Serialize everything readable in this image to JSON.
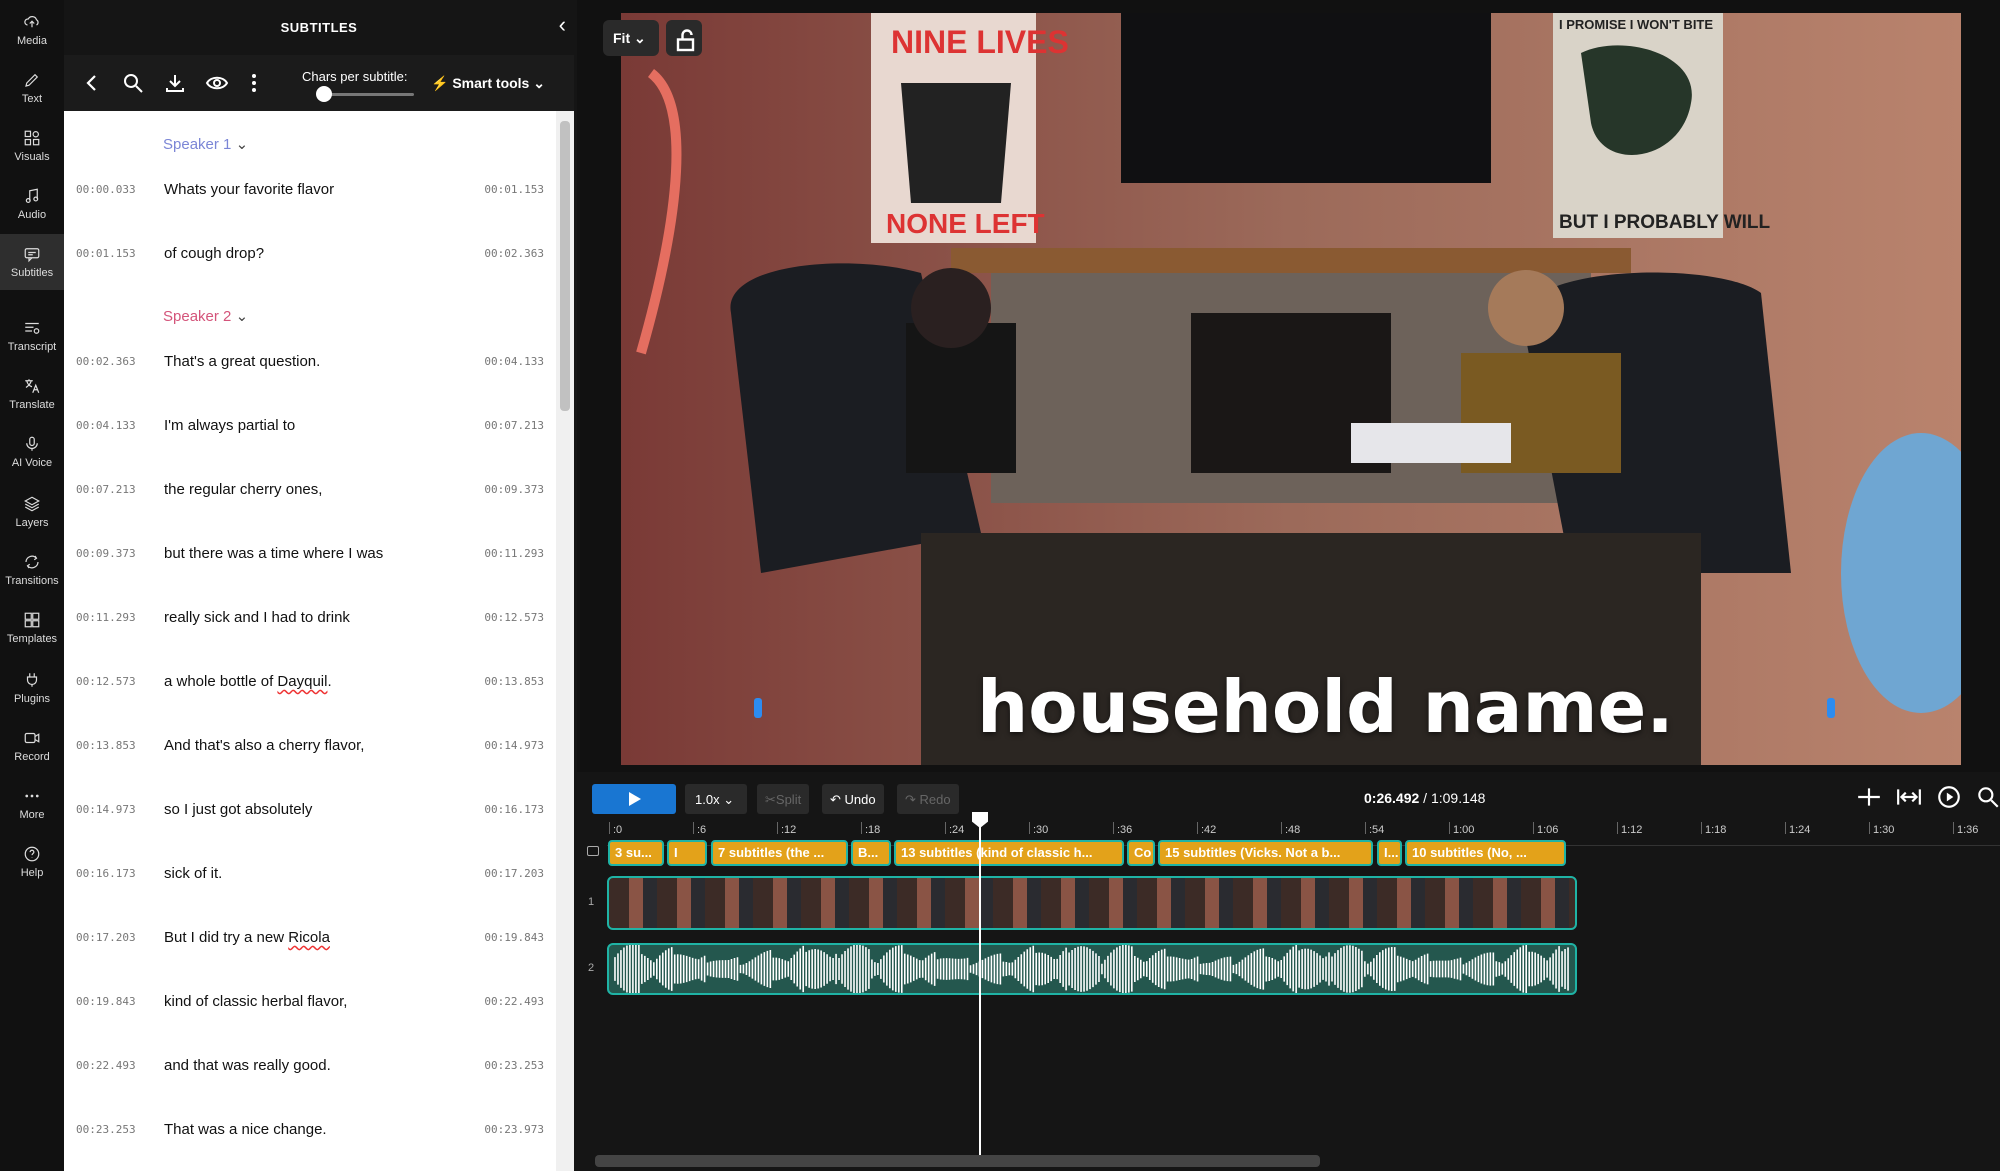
{
  "nav": {
    "items": [
      {
        "label": "Media",
        "icon": "cloud-upload-icon"
      },
      {
        "label": "Text",
        "icon": "pen-icon"
      },
      {
        "label": "Visuals",
        "icon": "shapes-icon"
      },
      {
        "label": "Audio",
        "icon": "music-note-icon"
      },
      {
        "label": "Subtitles",
        "icon": "subtitles-icon"
      },
      {
        "label": "Transcript",
        "icon": "transcript-icon"
      },
      {
        "label": "Translate",
        "icon": "translate-icon"
      },
      {
        "label": "AI Voice",
        "icon": "ai-voice-icon"
      },
      {
        "label": "Layers",
        "icon": "layers-icon"
      },
      {
        "label": "Transitions",
        "icon": "transitions-icon"
      },
      {
        "label": "Templates",
        "icon": "templates-icon"
      },
      {
        "label": "Plugins",
        "icon": "plugin-icon"
      },
      {
        "label": "Record",
        "icon": "record-icon"
      },
      {
        "label": "More",
        "icon": "more-icon"
      },
      {
        "label": "Help",
        "icon": "help-icon"
      }
    ],
    "active": "Subtitles"
  },
  "panel": {
    "title": "SUBTITLES",
    "chars_label": "Chars per subtitle:",
    "smart_tools": "Smart tools"
  },
  "speakers": [
    {
      "name": "Speaker 1",
      "color": "#7b86d6"
    },
    {
      "name": "Speaker 2",
      "color": "#d4547a"
    }
  ],
  "subtitles": [
    {
      "start": "00:00.033",
      "text": "Whats your favorite flavor",
      "end": "00:01.153"
    },
    {
      "start": "00:01.153",
      "text": "of cough drop?",
      "end": "00:02.363"
    },
    {
      "start": "00:02.363",
      "text": "That's a great question.",
      "end": "00:04.133"
    },
    {
      "start": "00:04.133",
      "text": "I'm always partial to",
      "end": "00:07.213"
    },
    {
      "start": "00:07.213",
      "text": "the regular cherry ones,",
      "end": "00:09.373"
    },
    {
      "start": "00:09.373",
      "text": "but there was a time where I was",
      "end": "00:11.293"
    },
    {
      "start": "00:11.293",
      "text": "really sick and I had to drink",
      "end": "00:12.573"
    },
    {
      "start": "00:12.573",
      "text": "a whole bottle of Dayquil.",
      "end": "00:13.853"
    },
    {
      "start": "00:13.853",
      "text": "And that's also a cherry flavor,",
      "end": "00:14.973"
    },
    {
      "start": "00:14.973",
      "text": "so I just got absolutely",
      "end": "00:16.173"
    },
    {
      "start": "00:16.173",
      "text": "sick of it.",
      "end": "00:17.203"
    },
    {
      "start": "00:17.203",
      "text": "But I did try a new Ricola",
      "end": "00:19.843"
    },
    {
      "start": "00:19.843",
      "text": "kind of classic herbal flavor,",
      "end": "00:22.493"
    },
    {
      "start": "00:22.493",
      "text": "and that was really good.",
      "end": "00:23.253"
    },
    {
      "start": "00:23.253",
      "text": "That was a nice change.",
      "end": "00:23.973"
    }
  ],
  "preview": {
    "fit_label": "Fit",
    "caption": "household name.",
    "poster_left_top": "NINE LIVES",
    "poster_left_bottom": "NONE LEFT",
    "poster_right_top": "I PROMISE I WON'T BITE",
    "poster_right_bottom": "BUT I PROBABLY WILL"
  },
  "timeline": {
    "speed": "1.0x",
    "split": "Split",
    "undo": "Undo",
    "redo": "Redo",
    "current_time": "0:26.492",
    "total_time": "1:09.148",
    "ticks": [
      ":0",
      ":6",
      ":12",
      ":18",
      ":24",
      ":30",
      ":36",
      ":42",
      ":48",
      ":54",
      "1:00",
      "1:06",
      "1:12",
      "1:18",
      "1:24",
      "1:30",
      "1:36"
    ],
    "subtitle_chips": [
      "3 su...",
      "I",
      "7 subtitles (the ...",
      "B...",
      "13 subtitles (kind of classic h...",
      "Co",
      "15 subtitles (Vicks. Not a b...",
      "I...",
      "10 subtitles (No, ..."
    ],
    "track_numbers": [
      "1",
      "2"
    ]
  }
}
